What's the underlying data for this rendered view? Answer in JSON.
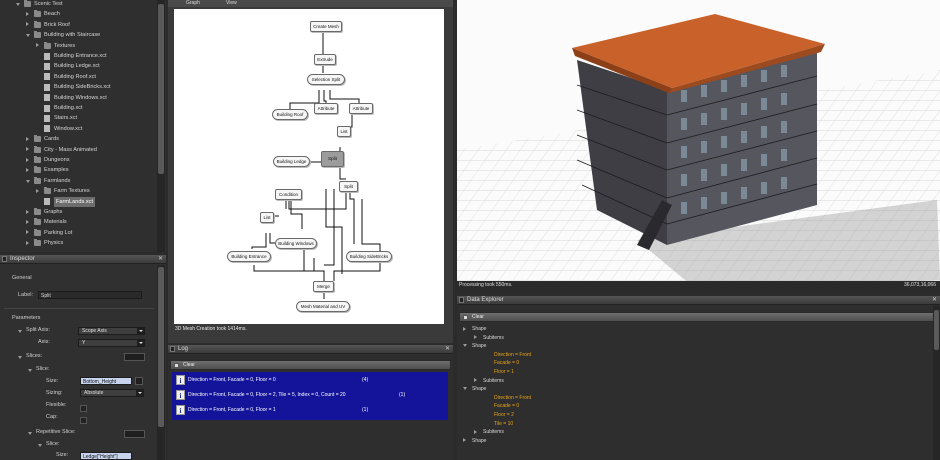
{
  "colors": {
    "accent_orange": "#e8a317",
    "log_selected_bg": "#14149a",
    "viewport_roof": "#c8612a"
  },
  "file_tree": {
    "items": [
      {
        "label": "Scenic Test",
        "icon": "folder-icon",
        "expanded": true
      },
      {
        "label": "Beach",
        "icon": "folder-icon"
      },
      {
        "label": "Brick Roof",
        "icon": "folder-icon"
      },
      {
        "label": "Building with Staircase",
        "icon": "folder-icon",
        "expanded": true
      },
      {
        "label": "Textures",
        "icon": "folder-icon"
      },
      {
        "label": "Building Entrance.xct",
        "icon": "file-icon"
      },
      {
        "label": "Building Ledge.xct",
        "icon": "file-icon"
      },
      {
        "label": "Building Roof.xct",
        "icon": "file-icon"
      },
      {
        "label": "Building SideBricks.xct",
        "icon": "file-icon"
      },
      {
        "label": "Building Windows.xct",
        "icon": "file-icon"
      },
      {
        "label": "Building.xct",
        "icon": "file-icon"
      },
      {
        "label": "Stairs.xct",
        "icon": "file-icon"
      },
      {
        "label": "Window.xct",
        "icon": "file-icon"
      },
      {
        "label": "Cards",
        "icon": "folder-icon"
      },
      {
        "label": "City - Mass Animated",
        "icon": "folder-icon"
      },
      {
        "label": "Dungeons",
        "icon": "folder-icon"
      },
      {
        "label": "Examples",
        "icon": "folder-icon"
      },
      {
        "label": "Farmlands",
        "icon": "folder-icon",
        "expanded": true
      },
      {
        "label": "Farm Textures",
        "icon": "folder-icon"
      },
      {
        "label": "FarmLands.xct",
        "icon": "file-icon",
        "selected": true
      },
      {
        "label": "Graphs",
        "icon": "folder-icon"
      },
      {
        "label": "Materials",
        "icon": "folder-icon"
      },
      {
        "label": "Parking Lot",
        "icon": "folder-icon"
      },
      {
        "label": "Physics",
        "icon": "folder-icon"
      }
    ]
  },
  "graph": {
    "menu": [
      "Graph",
      "View"
    ],
    "status": "3D Mesh Creation took 1414ms.",
    "nodes": [
      {
        "label": "Create Mesh"
      },
      {
        "label": "Extrude"
      },
      {
        "label": "Selection Split"
      },
      {
        "label": "Building Roof"
      },
      {
        "label": "Attribute"
      },
      {
        "label": "Attribute"
      },
      {
        "label": "List"
      },
      {
        "label": "Building Ledge"
      },
      {
        "label": "Split"
      },
      {
        "label": "Split"
      },
      {
        "label": "Condition"
      },
      {
        "label": "List"
      },
      {
        "label": "Building Windows"
      },
      {
        "label": "Building Entrance"
      },
      {
        "label": "Building SideBricks"
      },
      {
        "label": "Merge"
      },
      {
        "label": "Mesh Material and UV"
      }
    ]
  },
  "viewport": {
    "status": "Processing took 550ms.",
    "counter": "36,073,16,066"
  },
  "inspector": {
    "title": "Inspector",
    "general_header": "General",
    "label_caption": "Label:",
    "label_value": "Split",
    "parameters_header": "Parameters",
    "split_axis_label": "Split Axis:",
    "split_axis_value": "Scope Axis",
    "axis_label": "Axis:",
    "axis_value": "Y",
    "slices_label": "Slices:",
    "slice_label": "Slice:",
    "size_label": "Size:",
    "size_value": "Bottom_Height",
    "sizing_label": "Sizing:",
    "sizing_value": "Absolute",
    "flexible_label": "Flexible:",
    "cap_label": "Cap:",
    "repetitive_label": "Repetitive Slice:",
    "slice2_label": "Slice:",
    "size2_label": "Size:",
    "size2_value": "Ledge[\"Height\"]"
  },
  "log": {
    "title": "Log",
    "clear_label": "Clear",
    "rows": [
      {
        "text": "Direction = Front, Facade = 0, Floor = 0",
        "count": "(4)"
      },
      {
        "text": "Direction = Front, Facade = 0, Floor = 2, Tile = 5, Index = 0, Count = 20",
        "count": "(1)"
      },
      {
        "text": "Direction = Front, Facade = 0, Floor = 1",
        "count": "(1)"
      }
    ]
  },
  "data_explorer": {
    "title": "Data Explorer",
    "clear_label": "Clear",
    "rows": [
      {
        "text": "Shape",
        "indent": 0,
        "kind": "node"
      },
      {
        "text": "Subitems",
        "indent": 1,
        "kind": "node"
      },
      {
        "text": "Shape",
        "indent": 0,
        "kind": "node"
      },
      {
        "text": "Direction = Front",
        "indent": 2,
        "kind": "attr"
      },
      {
        "text": "Facade = 0",
        "indent": 2,
        "kind": "attr"
      },
      {
        "text": "Floor = 1",
        "indent": 2,
        "kind": "attr"
      },
      {
        "text": "Subitems",
        "indent": 1,
        "kind": "node"
      },
      {
        "text": "Shape",
        "indent": 0,
        "kind": "node"
      },
      {
        "text": "Direction = Front",
        "indent": 2,
        "kind": "attr"
      },
      {
        "text": "Facade = 0",
        "indent": 2,
        "kind": "attr"
      },
      {
        "text": "Floor = 2",
        "indent": 2,
        "kind": "attr"
      },
      {
        "text": "Tile = 10",
        "indent": 2,
        "kind": "attr"
      },
      {
        "text": "Subitems",
        "indent": 1,
        "kind": "node"
      },
      {
        "text": "Shape",
        "indent": 0,
        "kind": "node"
      }
    ]
  }
}
